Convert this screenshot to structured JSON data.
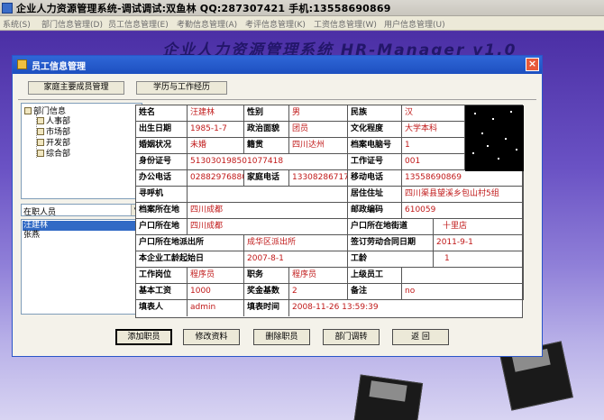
{
  "app": {
    "title": "企业人力资源管理系统-调试调试:双鱼林 QQ:287307421 手机:13558690869"
  },
  "menu": [
    "系统(S)",
    "部门信息管理(D)",
    "员工信息管理(E)",
    "考勤信息管理(A)",
    "考评信息管理(K)",
    "工资信息管理(W)",
    "用户信息管理(U)"
  ],
  "banner": "企业人力资源管理系统  HR-Manager v1.0",
  "dialog": {
    "title": "员工信息管理",
    "close": "×",
    "tabs": {
      "family": "家庭主要成员管理",
      "education": "学历与工作经历"
    }
  },
  "tree": {
    "root": "部门信息",
    "children": [
      "人事部",
      "市场部",
      "开发部",
      "综合部"
    ]
  },
  "filter": {
    "selected": "在职人员"
  },
  "employees": [
    "汪建林",
    "张燕"
  ],
  "form": {
    "name_label": "姓名",
    "name": "汪建林",
    "gender_label": "性别",
    "gender": "男",
    "ethnicity_label": "民族",
    "ethnicity": "汉",
    "birth_label": "出生日期",
    "birth": "1985-1-7",
    "political_label": "政治面貌",
    "political": "团员",
    "education_label": "文化程度",
    "education": "大学本科",
    "marital_label": "婚姻状况",
    "marital": "未婚",
    "native_label": "籍贯",
    "native": "四川达州",
    "archive_no_label": "档案电脑号",
    "archive_no": "1",
    "id_label": "身份证号",
    "id": "513030198501077418",
    "work_no_label": "工作证号",
    "work_no": "001",
    "office_tel_label": "办公电话",
    "office_tel": "02882976880",
    "home_tel_label": "家庭电话",
    "home_tel": "13308286717",
    "mobile_label": "移动电话",
    "mobile": "13558690869",
    "pager_label": "寻呼机",
    "pager": "",
    "address_label": "居住住址",
    "address": "四川渠县望溪乡包山村5组",
    "archive_loc_label": "档案所在地",
    "archive_loc": "四川成都",
    "postcode_label": "邮政编码",
    "postcode": "610059",
    "hukou_label": "户口所在地",
    "hukou": "四川成都",
    "hukou_street_label": "户口所在地街道",
    "hukou_street": "十里店",
    "police_label": "户口所在地派出所",
    "police": "成华区派出所",
    "contract_label": "签订劳动合同日期",
    "contract": "2011-9-1",
    "start_label": "本企业工龄起始日",
    "start": "2007-8-1",
    "seniority_label": "工龄",
    "seniority": "1",
    "post_label": "工作岗位",
    "post": "程序员",
    "title_label": "职务",
    "job_title": "程序员",
    "superior_label": "上级员工",
    "superior": "",
    "salary_label": "基本工资",
    "salary": "1000",
    "bonus_label": "奖金基数",
    "bonus": "2",
    "remark_label": "备注",
    "remark": "no",
    "filler_label": "填表人",
    "filler": "admin",
    "filltime_label": "填表时间",
    "filltime": "2008-11-26  13:59:39"
  },
  "buttons": {
    "add": "添加职员",
    "edit": "修改资料",
    "delete": "删除职员",
    "transfer": "部门调转",
    "back": "返  回"
  },
  "colors": {
    "title_bar": "#1d4fbf",
    "value_text": "#c01818",
    "selection": "#316ac5",
    "desktop": "#5a3ba8"
  }
}
